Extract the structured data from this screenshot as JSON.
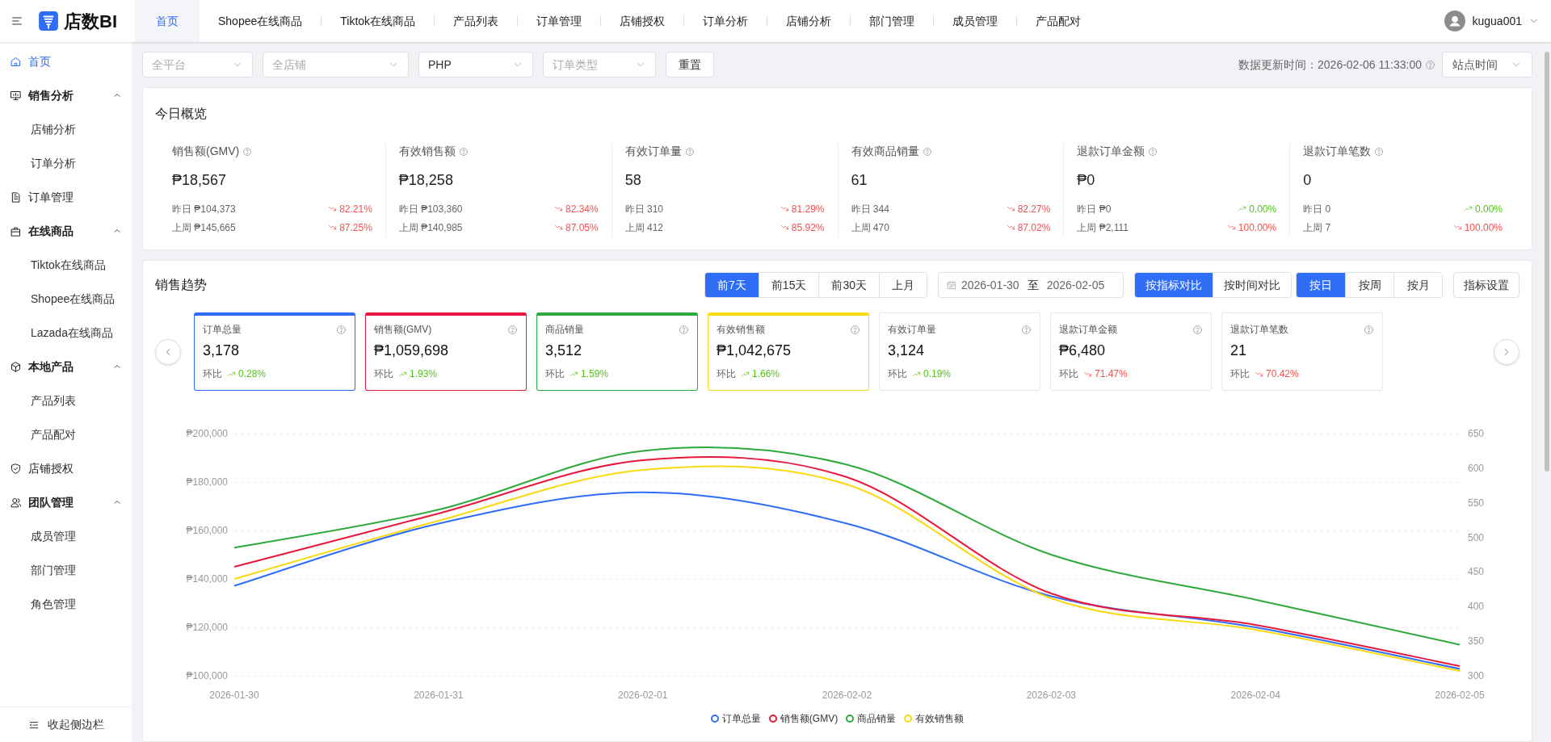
{
  "app": {
    "logo_text": "店数BI"
  },
  "top_tabs": [
    {
      "label": "首页",
      "selected": true
    },
    {
      "label": "Shopee在线商品",
      "selected": false
    },
    {
      "label": "Tiktok在线商品",
      "selected": false
    },
    {
      "label": "产品列表",
      "selected": false
    },
    {
      "label": "订单管理",
      "selected": false
    },
    {
      "label": "店铺授权",
      "selected": false
    },
    {
      "label": "订单分析",
      "selected": false
    },
    {
      "label": "店铺分析",
      "selected": false
    },
    {
      "label": "部门管理",
      "selected": false
    },
    {
      "label": "成员管理",
      "selected": false
    },
    {
      "label": "产品配对",
      "selected": false
    }
  ],
  "user": {
    "name": "kugua001"
  },
  "sidebar": {
    "items": [
      {
        "label": "首页",
        "kind": "home",
        "selected": true
      },
      {
        "label": "销售分析",
        "kind": "board",
        "expanded": true,
        "children": [
          {
            "label": "店铺分析",
            "selected": false
          },
          {
            "label": "订单分析",
            "selected": false
          }
        ]
      },
      {
        "label": "订单管理",
        "kind": "document",
        "selected": false
      },
      {
        "label": "在线商品",
        "kind": "bag",
        "expanded": true,
        "children": [
          {
            "label": "Tiktok在线商品",
            "selected": false
          },
          {
            "label": "Shopee在线商品",
            "selected": false
          },
          {
            "label": "Lazada在线商品",
            "selected": false
          }
        ]
      },
      {
        "label": "本地产品",
        "kind": "cube",
        "expanded": true,
        "children": [
          {
            "label": "产品列表",
            "selected": false
          },
          {
            "label": "产品配对",
            "selected": false
          }
        ]
      },
      {
        "label": "店铺授权",
        "kind": "shield",
        "selected": false
      },
      {
        "label": "团队管理",
        "kind": "users",
        "expanded": true,
        "children": [
          {
            "label": "成员管理",
            "selected": false
          },
          {
            "label": "部门管理",
            "selected": false
          },
          {
            "label": "角色管理",
            "selected": false
          }
        ]
      }
    ],
    "collapse_label": "收起侧边栏"
  },
  "filters": {
    "dropdowns": [
      {
        "placeholder": "全平台"
      },
      {
        "placeholder": "全店铺"
      },
      {
        "value": "PHP"
      },
      {
        "placeholder": "订单类型"
      }
    ],
    "reset_button": "重置",
    "update_time": "数据更新时间：2026-02-06 11:33:00",
    "timezone_select": "站点时间"
  },
  "overview": {
    "title": "今日概览",
    "metrics": [
      {
        "label": "销售额(GMV)",
        "value": "₱18,567",
        "rows": [
          {
            "label": "昨日 ₱104,373",
            "change": "82.21%",
            "kind": "down"
          },
          {
            "label": "上周 ₱145,665",
            "change": "87.25%",
            "kind": "down"
          }
        ]
      },
      {
        "label": "有效销售额",
        "value": "₱18,258",
        "rows": [
          {
            "label": "昨日 ₱103,360",
            "change": "82.34%",
            "kind": "down"
          },
          {
            "label": "上周 ₱140,985",
            "change": "87.05%",
            "kind": "down"
          }
        ]
      },
      {
        "label": "有效订单量",
        "value": "58",
        "rows": [
          {
            "label": "昨日 310",
            "change": "81.29%",
            "kind": "down"
          },
          {
            "label": "上周 412",
            "change": "85.92%",
            "kind": "down"
          }
        ]
      },
      {
        "label": "有效商品销量",
        "value": "61",
        "rows": [
          {
            "label": "昨日 344",
            "change": "82.27%",
            "kind": "down"
          },
          {
            "label": "上周 470",
            "change": "87.02%",
            "kind": "down"
          }
        ]
      },
      {
        "label": "退款订单金额",
        "value": "₱0",
        "rows": [
          {
            "label": "昨日 ₱0",
            "change": "0.00%",
            "kind": "up"
          },
          {
            "label": "上周 ₱2,111",
            "change": "100.00%",
            "kind": "down"
          }
        ]
      },
      {
        "label": "退款订单笔数",
        "value": "0",
        "rows": [
          {
            "label": "昨日 0",
            "change": "0.00%",
            "kind": "up"
          },
          {
            "label": "上周 7",
            "change": "100.00%",
            "kind": "down"
          }
        ]
      }
    ]
  },
  "trend": {
    "title": "销售趋势",
    "range_tabs": [
      {
        "label": "前7天",
        "selected": true
      },
      {
        "label": "前15天",
        "selected": false
      },
      {
        "label": "前30天",
        "selected": false
      },
      {
        "label": "上月",
        "selected": false
      }
    ],
    "date_from": "2026-01-30",
    "date_sep": "至",
    "date_to": "2026-02-05",
    "compare_tabs": [
      {
        "label": "按指标对比",
        "selected": true
      },
      {
        "label": "按时间对比",
        "selected": false
      }
    ],
    "granularity_tabs": [
      {
        "label": "按日",
        "selected": true
      },
      {
        "label": "按周",
        "selected": false
      },
      {
        "label": "按月",
        "selected": false
      }
    ],
    "settings_button": "指标设置",
    "metric_cards": [
      {
        "label": "订单总量",
        "value": "3,178",
        "change_label": "环比",
        "change": "0.28%",
        "kind": "up",
        "selected": true,
        "color": "#2f6df6"
      },
      {
        "label": "销售额(GMV)",
        "value": "₱1,059,698",
        "change_label": "环比",
        "change": "1.93%",
        "kind": "up",
        "selected": true,
        "color": "#e8173c"
      },
      {
        "label": "商品销量",
        "value": "3,512",
        "change_label": "环比",
        "change": "1.59%",
        "kind": "up",
        "selected": true,
        "color": "#2eaa3c"
      },
      {
        "label": "有效销售额",
        "value": "₱1,042,675",
        "change_label": "环比",
        "change": "1.66%",
        "kind": "up",
        "selected": true,
        "color": "#fad90f"
      },
      {
        "label": "有效订单量",
        "value": "3,124",
        "change_label": "环比",
        "change": "0.19%",
        "kind": "up",
        "selected": false
      },
      {
        "label": "退款订单金额",
        "value": "₱6,480",
        "change_label": "环比",
        "change": "71.47%",
        "kind": "down",
        "selected": false
      },
      {
        "label": "退款订单笔数",
        "value": "21",
        "change_label": "环比",
        "change": "70.42%",
        "kind": "down",
        "selected": false
      }
    ],
    "chart_data": {
      "type": "line",
      "grid": true,
      "legend": true,
      "categories": [
        "2026-01-30",
        "2026-01-31",
        "2026-02-01",
        "2026-02-02",
        "2026-02-03",
        "2026-02-04",
        "2026-02-05"
      ],
      "ylim": [
        100000,
        200000
      ],
      "yticks": [
        {
          "value": 100000,
          "label": "₱100,000"
        },
        {
          "value": 120000,
          "label": "₱120,000"
        },
        {
          "value": 140000,
          "label": "₱140,000"
        },
        {
          "value": 160000,
          "label": "₱160,000"
        },
        {
          "value": 180000,
          "label": "₱180,000"
        },
        {
          "value": 200000,
          "label": "₱200,000"
        }
      ],
      "y2lim": [
        300,
        650
      ],
      "y2ticks": [
        300,
        350,
        400,
        450,
        500,
        550,
        600,
        650
      ],
      "series": [
        {
          "name": "订单总量",
          "color": "#2f6df6",
          "axis": "y2",
          "values": [
            430,
            520,
            565,
            520,
            415,
            370,
            310
          ]
        },
        {
          "name": "销售额(GMV)",
          "color": "#e8173c",
          "values": [
            145000,
            167000,
            189000,
            182000,
            134000,
            121000,
            104000
          ]
        },
        {
          "name": "商品销量",
          "color": "#2eaa3c",
          "axis": "y2",
          "values": [
            485,
            540,
            625,
            605,
            475,
            410,
            345
          ]
        },
        {
          "name": "有效销售额",
          "color": "#fad90f",
          "values": [
            140000,
            164000,
            185000,
            179000,
            132000,
            119000,
            102000
          ]
        }
      ]
    }
  }
}
